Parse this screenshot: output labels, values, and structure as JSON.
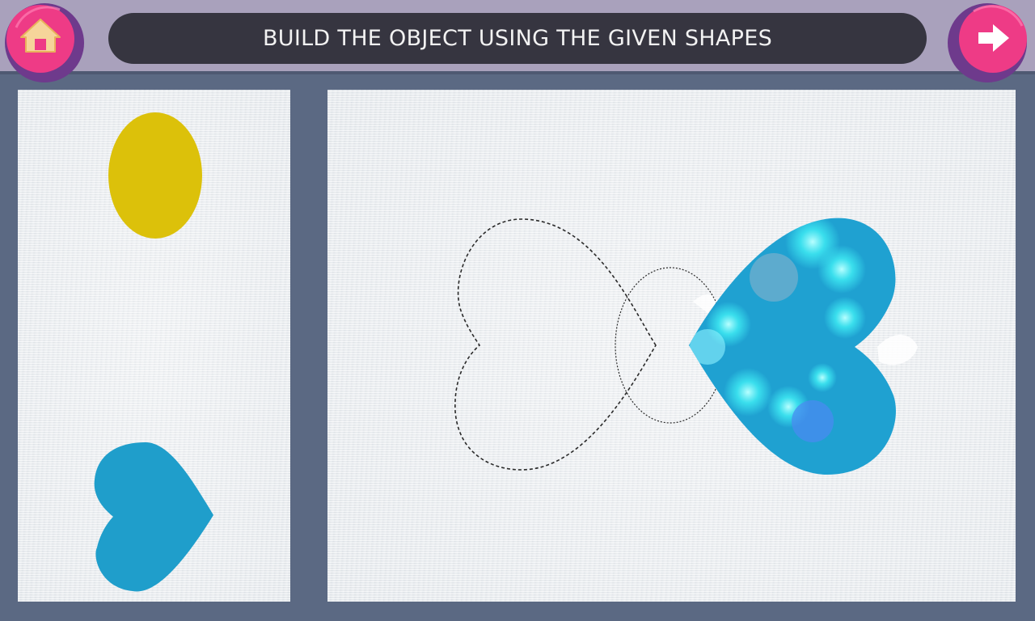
{
  "header": {
    "title": "BUILD THE OBJECT USING THE GIVEN SHAPES"
  },
  "buttons": {
    "home_icon": "house-icon",
    "next_icon": "arrow-right-icon"
  },
  "shapes_palette": {
    "shapes": [
      {
        "kind": "ellipse",
        "color": "#dcc10a"
      },
      {
        "kind": "heart",
        "color": "#1f9ecb"
      }
    ]
  },
  "build_area": {
    "outline_shapes": [
      "heart",
      "ellipse"
    ],
    "placed_shape": {
      "kind": "heart",
      "color": "#1fa1d1"
    }
  },
  "colors": {
    "button_fill": "#ee3b86",
    "button_ring": "#6e3a8c",
    "topbar": "#a9a1bc",
    "title_bg": "#363540",
    "background": "#5b6983"
  }
}
